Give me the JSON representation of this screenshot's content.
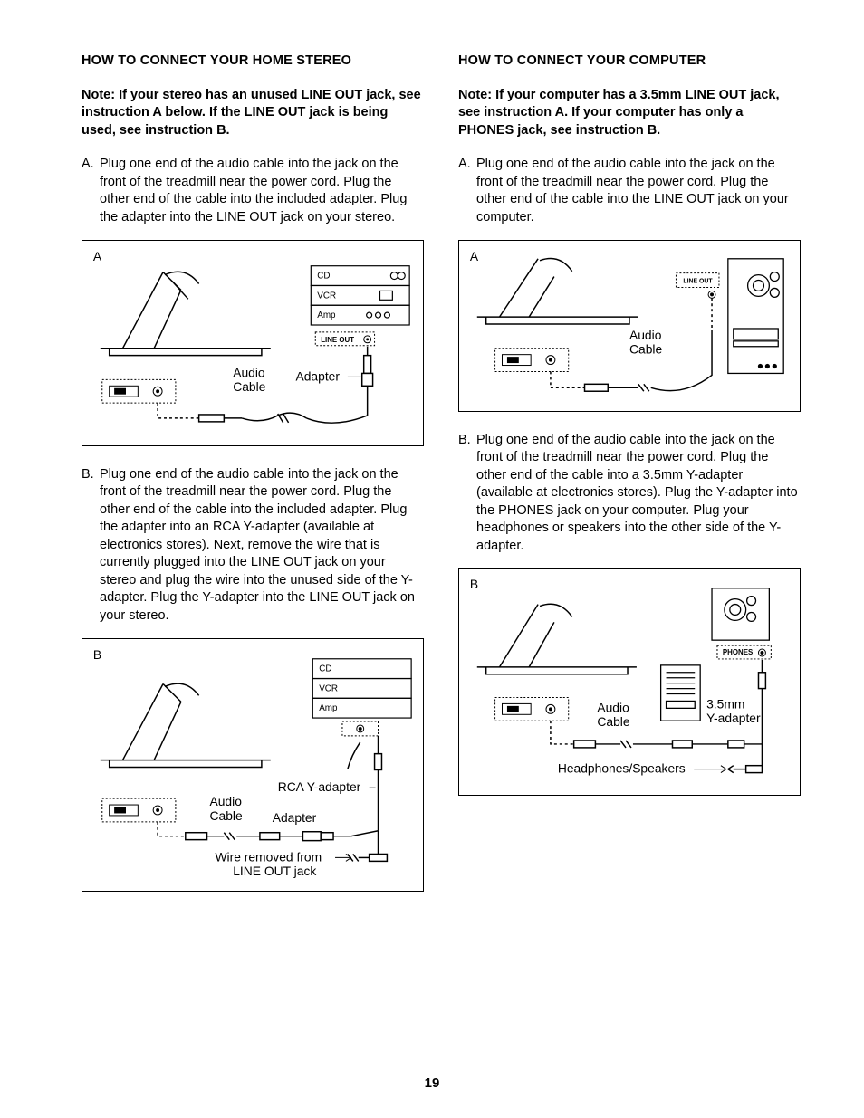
{
  "page_number": "19",
  "left": {
    "title": "HOW TO CONNECT YOUR HOME STEREO",
    "note": "Note: If your stereo has an unused LINE OUT jack, see instruction A below. If the LINE OUT jack is being used, see instruction B.",
    "stepA_letter": "A.",
    "stepA_body": "Plug one end of the audio cable into the jack on the front of the treadmill near the power cord. Plug the other end of the cable into the included adapter. Plug the adapter into the LINE OUT jack on your stereo.",
    "stepB_letter": "B.",
    "stepB_body": "Plug one end of the audio cable into the jack on the front of the treadmill near the power cord. Plug the other end of the cable into the included adapter. Plug the adapter into an RCA Y-adapter (available at electronics stores). Next, remove the wire that is currently plugged into the LINE OUT jack on your stereo and plug the wire into the unused side of the Y-adapter. Plug the Y-adapter into the LINE OUT jack on your stereo.",
    "figA": {
      "letter": "A",
      "cd": "CD",
      "vcr": "VCR",
      "amp": "Amp",
      "lineout": "LINE OUT",
      "audio_cable": "Audio\nCable",
      "adapter": "Adapter"
    },
    "figB": {
      "letter": "B",
      "cd": "CD",
      "vcr": "VCR",
      "amp": "Amp",
      "audio_cable": "Audio\nCable",
      "adapter": "Adapter",
      "rca": "RCA Y-adapter",
      "wire_removed": "Wire removed from\nLINE OUT jack"
    }
  },
  "right": {
    "title": "HOW TO CONNECT YOUR COMPUTER",
    "note": "Note: If your computer has a 3.5mm LINE OUT jack, see instruction A. If your computer has only a PHONES jack, see instruction B.",
    "stepA_letter": "A.",
    "stepA_body": "Plug one end of the audio cable into the jack on the front of the treadmill near the power cord. Plug the other end of the cable into the LINE OUT jack on your computer.",
    "stepB_letter": "B.",
    "stepB_body": "Plug one end of the audio cable into the jack on the front of the treadmill near the power cord. Plug the other end of the cable into a 3.5mm Y-adapter (available at electronics stores). Plug the Y-adapter into the PHONES jack on your computer. Plug your headphones or speakers into the other side of the Y-adapter.",
    "figA": {
      "letter": "A",
      "lineout": "LINE OUT",
      "audio_cable": "Audio\nCable"
    },
    "figB": {
      "letter": "B",
      "phones": "PHONES",
      "audio_cable": "Audio\nCable",
      "yadapter": "3.5mm\nY-adapter",
      "headphones": "Headphones/Speakers"
    }
  }
}
